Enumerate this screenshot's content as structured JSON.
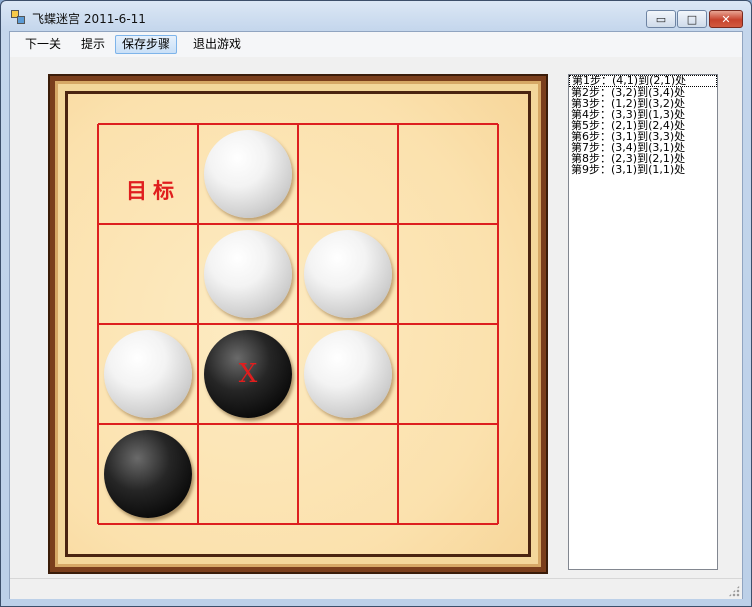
{
  "window": {
    "title": "飞蝶迷宫 2011-6-11",
    "minimize_glyph": "▭",
    "maximize_glyph": "□",
    "close_glyph": "✕"
  },
  "menu": {
    "items": [
      {
        "label": "下一关",
        "active": false
      },
      {
        "label": "提示",
        "active": false
      },
      {
        "label": "保存步骤",
        "active": true
      },
      {
        "label": "退出游戏",
        "active": false
      }
    ]
  },
  "board": {
    "rows": 4,
    "cols": 4,
    "target_label": "目标",
    "target_cell": {
      "row": 1,
      "col": 1
    },
    "pieces": [
      {
        "row": 1,
        "col": 2,
        "color": "white"
      },
      {
        "row": 2,
        "col": 2,
        "color": "white"
      },
      {
        "row": 2,
        "col": 3,
        "color": "white"
      },
      {
        "row": 3,
        "col": 1,
        "color": "white"
      },
      {
        "row": 3,
        "col": 2,
        "color": "black",
        "mark": "X"
      },
      {
        "row": 3,
        "col": 3,
        "color": "white"
      },
      {
        "row": 4,
        "col": 1,
        "color": "black"
      }
    ],
    "line_color": "#dd1f1f"
  },
  "moves": {
    "items": [
      "第1步：(4,1)到(2,1)处",
      "第2步：(3,2)到(3,4)处",
      "第3步：(1,2)到(3,2)处",
      "第4步：(3,3)到(1,3)处",
      "第5步：(2,1)到(2,4)处",
      "第6步：(3,1)到(3,3)处",
      "第7步：(3,4)到(3,1)处",
      "第8步：(2,3)到(2,1)处",
      "第9步：(3,1)到(1,1)处"
    ],
    "selected_index": 0
  }
}
